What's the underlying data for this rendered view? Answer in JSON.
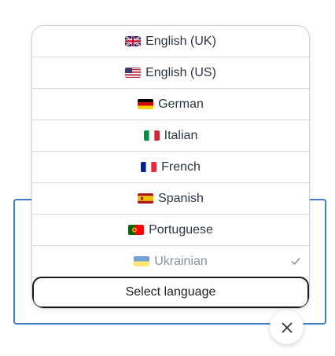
{
  "languages": [
    {
      "label": "English (UK)",
      "flag": "gb-flag-icon"
    },
    {
      "label": "English (US)",
      "flag": "us-flag-icon"
    },
    {
      "label": "German",
      "flag": "de-flag-icon"
    },
    {
      "label": "Italian",
      "flag": "it-flag-icon"
    },
    {
      "label": "French",
      "flag": "fr-flag-icon"
    },
    {
      "label": "Spanish",
      "flag": "es-flag-icon"
    },
    {
      "label": "Portuguese",
      "flag": "pt-flag-icon"
    },
    {
      "label": "Ukrainian",
      "flag": "ua-flag-icon",
      "selected": true
    }
  ],
  "select_label": "Select language",
  "icons": {
    "check": "check-icon",
    "close": "close-icon"
  },
  "colors": {
    "panel_border": "#3f80c8",
    "selected_text": "#8a8f98",
    "button_border": "#1a1a1a"
  }
}
